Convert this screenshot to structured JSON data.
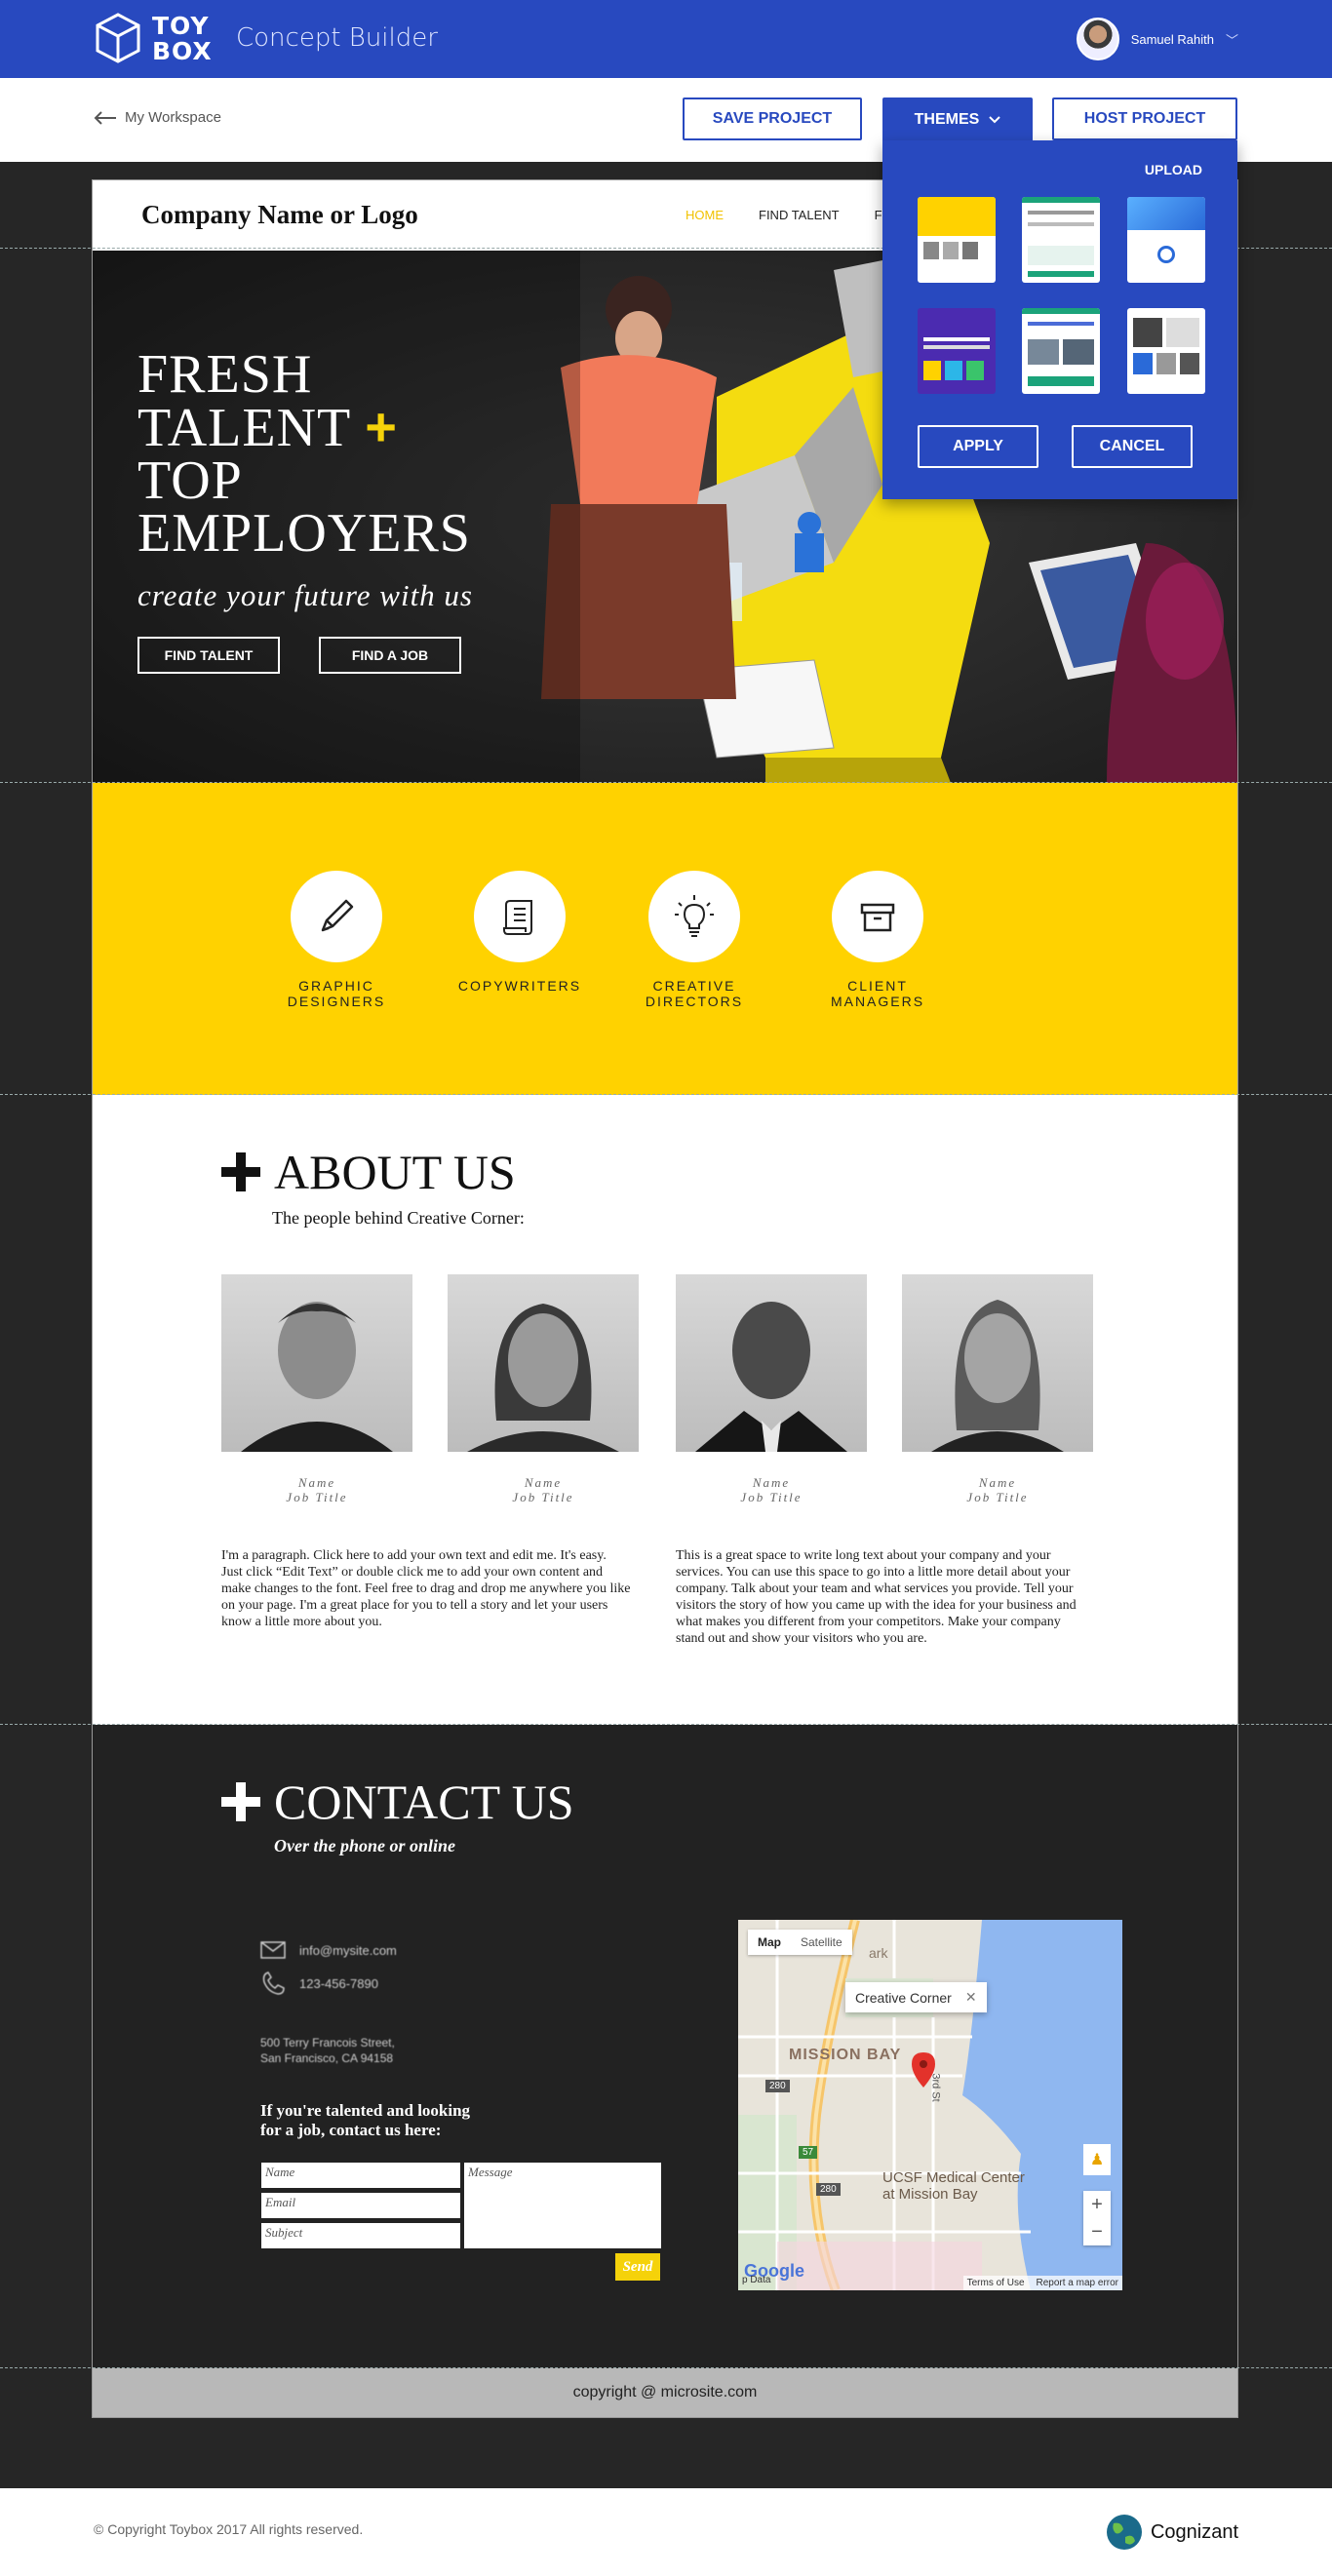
{
  "app": {
    "logo_line1": "TOY",
    "logo_line2": "BOX",
    "title": "Concept Builder",
    "user_name": "Samuel Rahith"
  },
  "toolbar": {
    "back_label": "My Workspace",
    "save_label": "SAVE PROJECT",
    "themes_label": "THEMES",
    "host_label": "HOST PROJECT"
  },
  "theme_panel": {
    "upload_label": "UPLOAD",
    "apply_label": "APPLY",
    "cancel_label": "CANCEL"
  },
  "site": {
    "logo": "Company Name or Logo",
    "nav": [
      "HOME",
      "FIND TALENT",
      "FIND"
    ],
    "hero": {
      "line1": "FRESH",
      "line2": "TALENT",
      "plus": "+",
      "line3": "TOP",
      "line4": "EMPLOYERS",
      "subtitle": "create your future with us",
      "btn_talent": "FIND TALENT",
      "btn_job": "FIND A JOB"
    },
    "services": [
      {
        "line1": "GRAPHIC",
        "line2": "DESIGNERS"
      },
      {
        "line1": "COPYWRITERS",
        "line2": ""
      },
      {
        "line1": "CREATIVE",
        "line2": "DIRECTORS"
      },
      {
        "line1": "CLIENT",
        "line2": "MANAGERS"
      }
    ],
    "about": {
      "title": "ABOUT US",
      "subtitle": "The people behind Creative Corner:",
      "people": [
        {
          "name": "Name",
          "title": "Job Title"
        },
        {
          "name": "Name",
          "title": "Job Title"
        },
        {
          "name": "Name",
          "title": "Job Title"
        },
        {
          "name": "Name",
          "title": "Job Title"
        }
      ],
      "para1": "I'm a paragraph. Click here to add your own text and edit me. It's easy. Just click “Edit Text” or double click me to add your own content and make changes to the font. Feel free to drag and drop me anywhere you like on your page. I'm a great place for you to tell a story and let your users know a little more about you.",
      "para2": "This is a great space to write long text about your company and your services. You can use this space to go into a little more detail about your company. Talk about your team and what services you provide. Tell your visitors the story of how you came up with the idea for your business and what makes you different from your competitors. Make your company stand out and show your visitors who you are."
    },
    "contact": {
      "title": "CONTACT US",
      "subtitle": "Over the phone or online",
      "email": "info@mysite.com",
      "phone": "123-456-7890",
      "address1": "500 Terry Francois Street,",
      "address2": "San Francisco, CA 94158",
      "prompt1": "If you're talented and looking",
      "prompt2": "for a job, contact us here:",
      "name_ph": "Name",
      "email_ph": "Email",
      "subject_ph": "Subject",
      "message_ph": "Message",
      "send_label": "Send",
      "map": {
        "tab_map": "Map",
        "tab_satellite": "Satellite",
        "marker_label": "Creative Corner",
        "area": "MISSION BAY",
        "poi1": "UCSF Medical Center",
        "poi2": "at Mission Bay",
        "street": "3rd St",
        "hwy1": "280",
        "hwy2": "280",
        "hwy3": "57",
        "park": "ark",
        "terms": "Terms of Use",
        "report": "Report a map error",
        "google": "Google",
        "mapdata": "p Data"
      }
    },
    "copyright": "copyright @ microsite.com"
  },
  "footer": {
    "copyright": "Copyright Toybox 2017 All rights reserved.",
    "brand": "Cognizant"
  },
  "colors": {
    "brand_blue": "#2849bf",
    "accent_yellow": "#ffd200",
    "dark": "#222222"
  }
}
